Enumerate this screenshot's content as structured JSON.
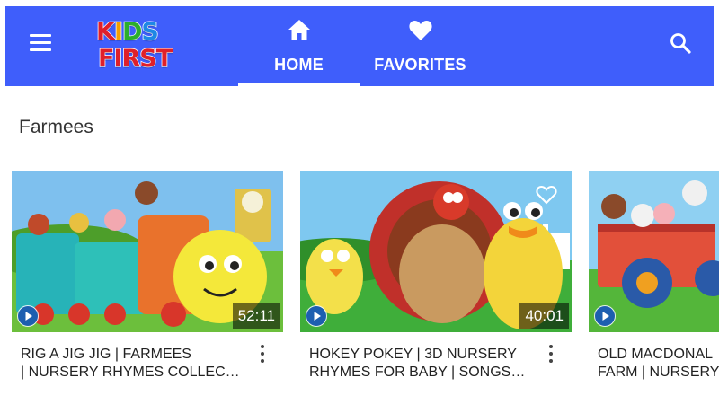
{
  "app": {
    "logo_top": "KIDS",
    "logo_bottom": "FIRST",
    "menu_icon": "hamburger-menu-icon",
    "search_icon": "search-icon",
    "accent_color": "#3f5efb"
  },
  "tabs": [
    {
      "label": "HOME",
      "icon": "home-icon",
      "active": true
    },
    {
      "label": "FAVORITES",
      "icon": "heart-icon",
      "active": false
    }
  ],
  "section": {
    "title": "Farmees"
  },
  "videos": [
    {
      "title_line1": "RIG A JIG JIG | FARMEES",
      "title_line2": "| NURSERY RHYMES COLLEC…",
      "duration": "52:11"
    },
    {
      "title_line1": "HOKEY POKEY | 3D NURSERY",
      "title_line2": "RHYMES FOR BABY | SONGS…",
      "duration": "40:01"
    },
    {
      "title_line1": "OLD MACDONAL",
      "title_line2": "FARM | NURSERY",
      "duration": ""
    }
  ]
}
